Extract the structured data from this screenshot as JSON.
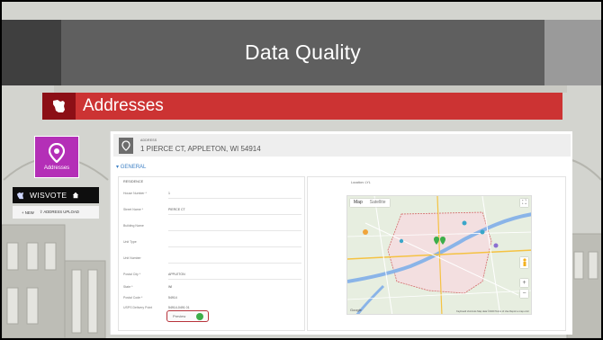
{
  "slide": {
    "title": "Data Quality",
    "section_title": "Addresses"
  },
  "tile": {
    "label": "Addresses"
  },
  "wisvote": {
    "title": "WISVOTE",
    "new_label": "NEW",
    "upload_label": "ADDRESS UPLOAD"
  },
  "record": {
    "header_label": "ADDRESS",
    "address_line": "1 PIERCE CT, APPLETON, WI 54914",
    "general_label": "GENERAL",
    "residence_title": "RESIDENCE",
    "geo_label": "Location: LYL",
    "fields": [
      {
        "label": "House Number *",
        "value": "1"
      },
      {
        "label": "Street Name *",
        "value": "PIERCE CT"
      },
      {
        "label": "Building Name",
        "value": ""
      },
      {
        "label": "Unit Type",
        "value": ""
      },
      {
        "label": "Unit Number",
        "value": ""
      },
      {
        "label": "Postal City *",
        "value": "APPLETON"
      },
      {
        "label": "State *",
        "value": "WI"
      },
      {
        "label": "Postal Code *",
        "value": "54914"
      },
      {
        "label": "USPS Delivery Point",
        "value": "54914-0491 01"
      }
    ],
    "preview_label": "Preview"
  },
  "map": {
    "tabs": [
      "Map",
      "Satellite"
    ],
    "footer": "Keyboard shortcuts   Map data ©2020   Terms of Use   Report a map error",
    "brand": "Google"
  },
  "colors": {
    "title_bar": "#5f5f5f",
    "section": "#cc3333",
    "tile": "#b42fb7",
    "marker": "#3cae4a"
  }
}
